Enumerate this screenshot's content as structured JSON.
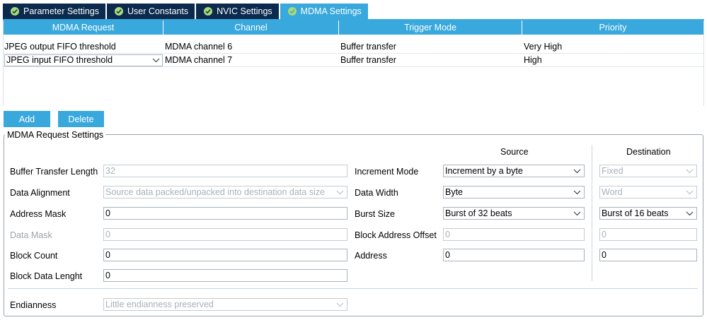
{
  "tabs": [
    {
      "label": "Parameter Settings",
      "active": false
    },
    {
      "label": "User Constants",
      "active": false
    },
    {
      "label": "NVIC Settings",
      "active": false
    },
    {
      "label": "MDMA Settings",
      "active": true
    }
  ],
  "table": {
    "headers": [
      "MDMA Request",
      "Channel",
      "Trigger Mode",
      "Priority"
    ],
    "rows": [
      {
        "request": "JPEG output FIFO threshold",
        "channel": "MDMA channel 6",
        "trigger": "Buffer transfer",
        "priority": "Very High"
      },
      {
        "request": "JPEG input FIFO threshold",
        "channel": "MDMA channel 7",
        "trigger": "Buffer transfer",
        "priority": "High"
      }
    ]
  },
  "buttons": {
    "add": "Add",
    "delete": "Delete"
  },
  "settings": {
    "title": "MDMA Request Settings",
    "source_header": "Source",
    "destination_header": "Destination",
    "buffer_transfer_length": {
      "label": "Buffer Transfer Length",
      "value": "32"
    },
    "data_alignment": {
      "label": "Data Alignment",
      "value": "Source data packed/unpacked into destination data size"
    },
    "address_mask": {
      "label": "Address Mask",
      "value": "0"
    },
    "data_mask": {
      "label": "Data Mask",
      "value": "0"
    },
    "block_count": {
      "label": "Block Count",
      "value": "0"
    },
    "block_data_length": {
      "label": "Block Data Lenght",
      "value": "0"
    },
    "endianness": {
      "label": "Endianness",
      "value": "Little endianness preserved"
    },
    "increment_mode": {
      "label": "Increment Mode",
      "source": "Increment by a byte",
      "destination": "Fixed"
    },
    "data_width": {
      "label": "Data Width",
      "source": "Byte",
      "destination": "Word"
    },
    "burst_size": {
      "label": "Burst Size",
      "source": "Burst of 32 beats",
      "destination": "Burst of 16 beats"
    },
    "block_address_offset": {
      "label": "Block Address Offset",
      "source": "0",
      "destination": "0"
    },
    "address": {
      "label": "Address",
      "source": "0",
      "destination": "0"
    }
  },
  "colors": {
    "accent": "#39a8dc",
    "tab_dark": "#0b2a4d",
    "check": "#a9d97a"
  }
}
